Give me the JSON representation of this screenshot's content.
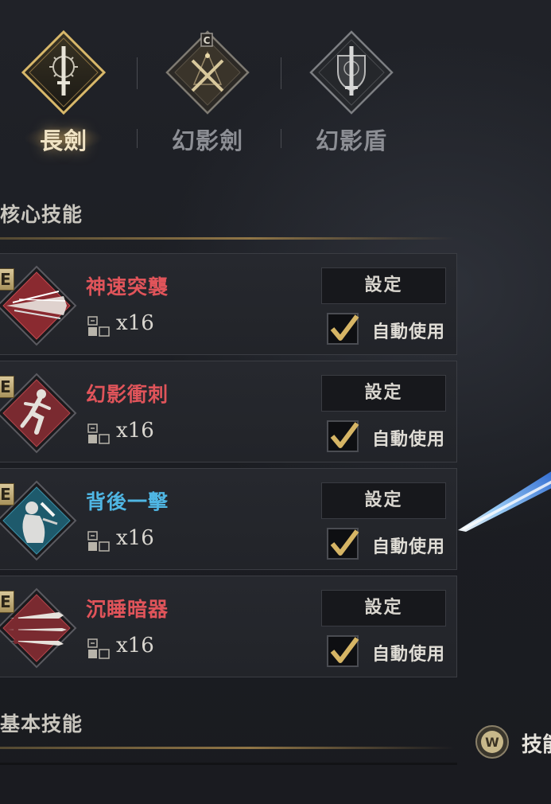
{
  "colors": {
    "accent_gold": "#c9a869",
    "skill_red": "#e0545a",
    "skill_blue": "#4fb6e3",
    "check_gold": "#d6b565"
  },
  "weapon_tabs": [
    {
      "label": "長劍",
      "icon": "longsword-emblem-icon",
      "active": true
    },
    {
      "label": "幻影劍",
      "icon": "crossed-blades-emblem-icon",
      "active": false
    },
    {
      "label": "幻影盾",
      "icon": "shield-sword-emblem-icon",
      "active": false
    }
  ],
  "core_skills": {
    "title": "核心技能",
    "items": [
      {
        "grade": "E",
        "name": "神速突襲",
        "name_color": "red",
        "icon": "dash-strike-icon",
        "cost": "x16",
        "settings_label": "設定",
        "auto_label": "自動使用",
        "auto_use": true
      },
      {
        "grade": "E",
        "name": "幻影衝刺",
        "name_color": "red",
        "icon": "running-figure-icon",
        "cost": "x16",
        "settings_label": "設定",
        "auto_label": "自動使用",
        "auto_use": true
      },
      {
        "grade": "E",
        "name": "背後一擊",
        "name_color": "blue",
        "icon": "back-stab-icon",
        "cost": "x16",
        "settings_label": "設定",
        "auto_label": "自動使用",
        "auto_use": true
      },
      {
        "grade": "E",
        "name": "沉睡暗器",
        "name_color": "red",
        "icon": "throwing-knives-icon",
        "cost": "x16",
        "settings_label": "設定",
        "auto_label": "自動使用",
        "auto_use": true
      }
    ]
  },
  "basic_skills": {
    "title": "基本技能"
  },
  "hint": {
    "key": "W",
    "text": "技能"
  }
}
